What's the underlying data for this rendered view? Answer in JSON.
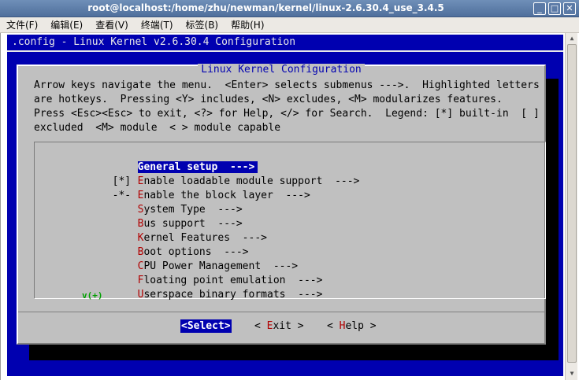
{
  "window": {
    "title": "root@localhost:/home/zhu/newman/kernel/linux-2.6.30.4_use_3.4.5",
    "minimize": "_",
    "maximize": "□",
    "close": "✕"
  },
  "menubar": {
    "items": [
      "文件(F)",
      "编辑(E)",
      "查看(V)",
      "终端(T)",
      "标签(B)",
      "帮助(H)"
    ]
  },
  "terminal": {
    "header": ".config - Linux Kernel v2.6.30.4 Configuration"
  },
  "dialog": {
    "title": "Linux Kernel Configuration",
    "help_lines": [
      "Arrow keys navigate the menu.  <Enter> selects submenus --->.  Highlighted letters",
      "are hotkeys.  Pressing <Y> includes, <N> excludes, <M> modularizes features.",
      "Press <Esc><Esc> to exit, <?> for Help, </> for Search.  Legend: [*] built-in  [ ]",
      "excluded  <M> module  < > module capable"
    ],
    "menu": [
      {
        "prefix": "",
        "hot": "",
        "rest": "General setup  --->",
        "selected": true,
        "full": "General setup  --->"
      },
      {
        "prefix": "[*]",
        "hot": "E",
        "rest": "nable loadable module support  --->",
        "selected": false
      },
      {
        "prefix": "-*-",
        "hot": "E",
        "rest": "nable the block layer  --->",
        "selected": false
      },
      {
        "prefix": "",
        "hot": "S",
        "rest": "ystem Type  --->",
        "selected": false
      },
      {
        "prefix": "",
        "hot": "B",
        "rest": "us support  --->",
        "selected": false
      },
      {
        "prefix": "",
        "hot": "K",
        "rest": "ernel Features  --->",
        "selected": false
      },
      {
        "prefix": "",
        "hot": "B",
        "rest": "oot options  --->",
        "selected": false
      },
      {
        "prefix": "",
        "hot": "C",
        "rest": "PU Power Management  --->",
        "selected": false
      },
      {
        "prefix": "",
        "hot": "F",
        "rest": "loating point emulation  --->",
        "selected": false
      },
      {
        "prefix": "",
        "hot": "U",
        "rest": "serspace binary formats  --->",
        "selected": false
      }
    ],
    "more_indicator": "v(+)",
    "buttons": {
      "select": "<Select>",
      "exit_pre": "< ",
      "exit_hot": "E",
      "exit_rest": "xit >",
      "help_pre": "< ",
      "help_hot": "H",
      "help_rest": "elp >"
    }
  },
  "colors": {
    "terminal_bg": "#0000b0",
    "dialog_bg": "#c0c0c0",
    "hotkey": "#b00000",
    "selected_bg": "#0000b0"
  }
}
